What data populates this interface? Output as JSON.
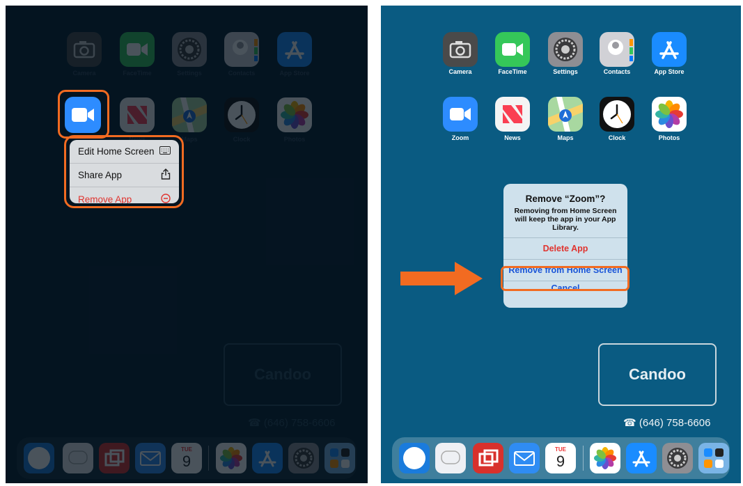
{
  "icons": [
    {
      "id": "camera",
      "label": "Camera"
    },
    {
      "id": "facetime",
      "label": "FaceTime"
    },
    {
      "id": "settings",
      "label": "Settings"
    },
    {
      "id": "contacts",
      "label": "Contacts"
    },
    {
      "id": "appstore",
      "label": "App Store"
    },
    {
      "id": "zoom",
      "label": "Zoom"
    },
    {
      "id": "news",
      "label": "News"
    },
    {
      "id": "maps",
      "label": "Maps"
    },
    {
      "id": "clock",
      "label": "Clock"
    },
    {
      "id": "photos",
      "label": "Photos"
    }
  ],
  "context_menu": {
    "items": [
      {
        "label": "Edit Home Screen",
        "icon": "keyboard-icon"
      },
      {
        "label": "Share App",
        "icon": "share-icon"
      },
      {
        "label": "Remove App",
        "icon": "minus-circle-icon",
        "destructive": true
      }
    ]
  },
  "alert": {
    "title": "Remove “Zoom”?",
    "message": "Removing from Home Screen will keep the app in your App Library.",
    "delete_label": "Delete App",
    "remove_label": "Remove from Home Screen",
    "cancel_label": "Cancel"
  },
  "calendar": {
    "weekday": "TUE",
    "day": "9"
  },
  "watermark": {
    "brand": "Candoo",
    "phone": "☎ (646) 758-6606"
  },
  "colors": {
    "highlight": "#f26b21",
    "destructive": "#e0342f",
    "action_blue": "#1a55d8"
  }
}
